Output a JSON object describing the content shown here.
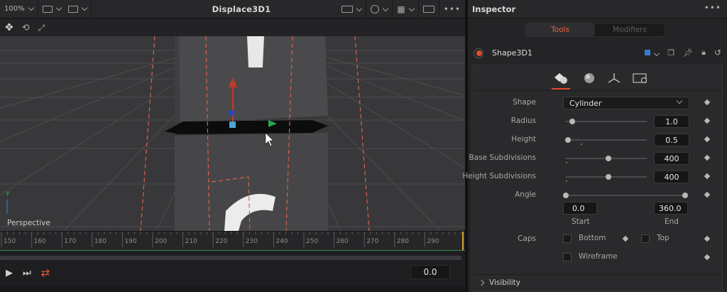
{
  "viewer": {
    "zoom": "100%",
    "title": "Displace3D1",
    "viewport_label": "Perspective",
    "axis_label": "Y",
    "timeline_ticks": [
      "150",
      "160",
      "170",
      "180",
      "190",
      "200",
      "210",
      "220",
      "230",
      "240",
      "250",
      "260",
      "270",
      "280",
      "290"
    ],
    "current_frame": "0.0"
  },
  "inspector": {
    "title": "Inspector",
    "tabs": [
      {
        "label": "Tools",
        "active": true
      },
      {
        "label": "Modifiers",
        "active": false
      }
    ],
    "tool_name": "Shape3D1",
    "shape": {
      "label": "Shape",
      "value": "Cylinder"
    },
    "sliders": [
      {
        "label": "Radius",
        "value": "1.0",
        "position": 0.08
      },
      {
        "label": "Height",
        "value": "0.5",
        "position": 0.03
      },
      {
        "label": "Base Subdivisions",
        "value": "400",
        "position": 0.53
      },
      {
        "label": "Height Subdivisions",
        "value": "400",
        "position": 0.53
      }
    ],
    "angle": {
      "label": "Angle",
      "start": "0.0",
      "end": "360.0",
      "start_label": "Start",
      "end_label": "End"
    },
    "caps": {
      "label": "Caps",
      "bottom": "Bottom",
      "top": "Top"
    },
    "wireframe": "Wireframe",
    "visibility": "Visibility"
  },
  "colors": {
    "accent": "#e8613a",
    "record": "#e24b2b",
    "swatch": "#3a7bd5"
  }
}
